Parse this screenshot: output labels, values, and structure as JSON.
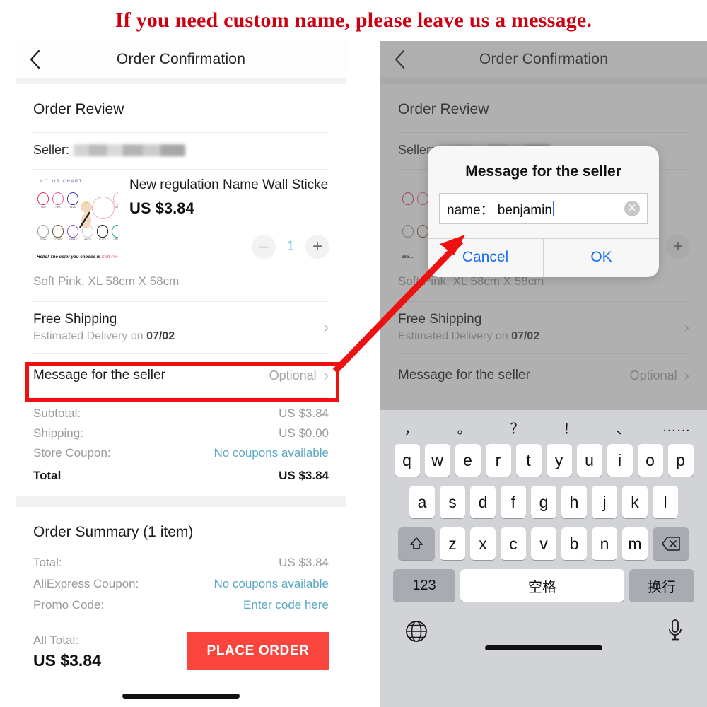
{
  "banner": {
    "text": "If you need custom name, please leave us a message."
  },
  "left_phone": {
    "nav": {
      "back_icon": "chevron-left-icon",
      "title": "Order Confirmation"
    },
    "order_review": {
      "heading": "Order Review",
      "seller_label": "Seller:"
    },
    "product": {
      "name": "New regulation Name Wall Sticke…",
      "price": "US $3.84",
      "quantity": "1",
      "minus_label": "–",
      "plus_label": "+",
      "variant": "Soft Pink, XL 58cm X 58cm",
      "thumb_caption_top": "COLOR CHART",
      "thumb_caption_bottom": "Hello! The color you choose is ",
      "thumb_caption_bottom_accent": "Soft Pink",
      "thumb_colors_row1": [
        "RED",
        "PINK",
        "BLUE",
        "SOFT PINK"
      ],
      "thumb_colors_row2": [
        "GRAY",
        "COFFEE",
        "PURPLE",
        "WHITE",
        "BLACK",
        "GREEN"
      ]
    },
    "shipping": {
      "title": "Free Shipping",
      "subtitle_prefix": "Estimated Delivery on ",
      "subtitle_date": "07/02",
      "chevron": "›"
    },
    "message_row": {
      "label": "Message for the seller",
      "value": "Optional",
      "chevron": "›"
    },
    "totals": [
      {
        "label": "Subtotal:",
        "value": "US $3.84",
        "link": false
      },
      {
        "label": "Shipping:",
        "value": "US $0.00",
        "link": false
      },
      {
        "label": "Store Coupon:",
        "value": "No coupons available",
        "link": true
      },
      {
        "label": "Total",
        "value": "US $3.84",
        "link": false,
        "bold": true
      }
    ],
    "summary": {
      "heading": "Order Summary (1 item)",
      "rows": [
        {
          "label": "Total:",
          "value": "US $3.84",
          "link": false
        },
        {
          "label": "AliExpress Coupon:",
          "value": "No coupons available",
          "link": true
        },
        {
          "label": "Promo Code:",
          "value": "Enter code here",
          "link": true
        }
      ]
    },
    "footer": {
      "all_total_label": "All Total:",
      "all_total_value": "US $3.84",
      "place_order_label": "PLACE ORDER"
    }
  },
  "right_phone": {
    "nav": {
      "back_icon": "chevron-left-icon",
      "title": "Order Confirmation"
    },
    "order_review": {
      "heading": "Order Review",
      "seller_label": "Seller:"
    },
    "product": {
      "name_tail": "cke…",
      "variant": "Soft Pink, XL 58cm X 58cm",
      "plus_label": "+"
    },
    "shipping": {
      "title": "Free Shipping",
      "subtitle_prefix": "Estimated Delivery on ",
      "subtitle_date": "07/02",
      "chevron": "›"
    },
    "message_row": {
      "label": "Message for the seller",
      "value": "Optional",
      "chevron": "›"
    },
    "dialog": {
      "title": "Message for the seller",
      "input_value": "name： benjamin",
      "input_placeholder": "",
      "clear_icon": "clear-circle-icon",
      "cancel_label": "Cancel",
      "ok_label": "OK"
    },
    "keyboard": {
      "suggestions": [
        "，",
        "。",
        "？",
        "！",
        "、",
        "……"
      ],
      "row1": [
        "q",
        "w",
        "e",
        "r",
        "t",
        "y",
        "u",
        "i",
        "o",
        "p"
      ],
      "row2": [
        "a",
        "s",
        "d",
        "f",
        "g",
        "h",
        "j",
        "k",
        "l"
      ],
      "row3": [
        "z",
        "x",
        "c",
        "v",
        "b",
        "n",
        "m"
      ],
      "shift_icon": "shift-arrow-icon",
      "backspace_icon": "backspace-icon",
      "numeric_label": "123",
      "space_label": "空格",
      "return_label": "换行",
      "globe_icon": "globe-icon",
      "mic_icon": "microphone-icon"
    }
  },
  "annotations": {
    "highlight_box_color": "#ee1111",
    "arrow_color": "#ee1111",
    "banner_color": "#cc0011",
    "accent_red": "#f9453e",
    "link_blue": "#5aa8c4",
    "dialog_blue": "#1a6cf0"
  }
}
